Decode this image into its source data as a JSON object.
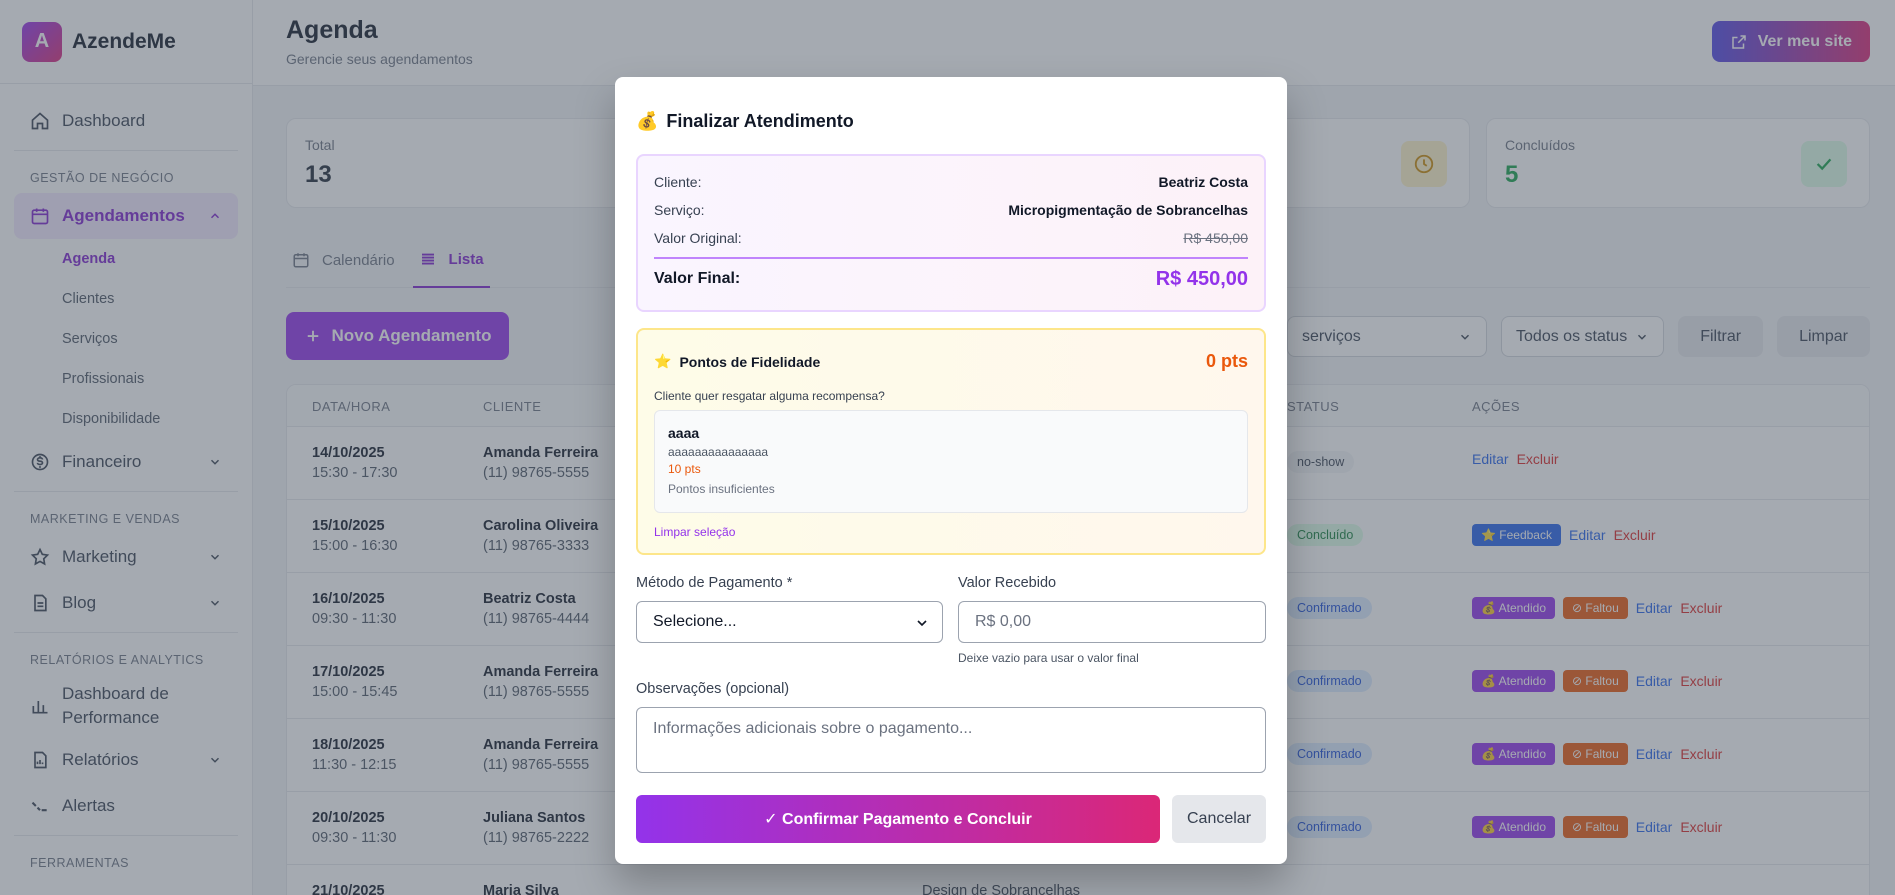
{
  "brand": {
    "logo_letter": "A",
    "name": "AzendeMe"
  },
  "sidebar": {
    "dashboard": "Dashboard",
    "section_business": "GESTÃO DE NEGÓCIO",
    "agendamentos": "Agendamentos",
    "sub_items": [
      "Agenda",
      "Clientes",
      "Serviços",
      "Profissionais",
      "Disponibilidade"
    ],
    "financeiro": "Financeiro",
    "section_marketing": "MARKETING E VENDAS",
    "marketing": "Marketing",
    "blog": "Blog",
    "section_reports": "RELATÓRIOS E ANALYTICS",
    "dashboard_perf_line1": "Dashboard de",
    "dashboard_perf_line2": "Performance",
    "relatorios": "Relatórios",
    "alertas": "Alertas",
    "section_tools": "FERRAMENTAS"
  },
  "header": {
    "title": "Agenda",
    "subtitle": "Gerencie seus agendamentos",
    "site_button": "Ver meu site"
  },
  "stats": [
    {
      "label": "Total",
      "value": "13"
    },
    {
      "label": "Concluídos",
      "value": "5"
    }
  ],
  "tabs": {
    "calendar": "Calendário",
    "list": "Lista"
  },
  "new_button": "Novo Agendamento",
  "filters": {
    "services": "serviços",
    "status": "Todos os status",
    "filter": "Filtrar",
    "clear": "Limpar"
  },
  "table": {
    "headers": {
      "datetime": "DATA/HORA",
      "client": "CLIENTE",
      "status": "STATUS",
      "actions": "AÇÕES"
    },
    "rows": [
      {
        "date": "14/10/2025",
        "time": "15:30 - 17:30",
        "client": "Amanda Ferreira",
        "phone": "(11) 98765-5555",
        "status": "no-show"
      },
      {
        "date": "15/10/2025",
        "time": "15:00 - 16:30",
        "client": "Carolina Oliveira",
        "phone": "(11) 98765-3333",
        "status": "Concluído"
      },
      {
        "date": "16/10/2025",
        "time": "09:30 - 11:30",
        "client": "Beatriz Costa",
        "phone": "(11) 98765-4444",
        "status": "Confirmado"
      },
      {
        "date": "17/10/2025",
        "time": "15:00 - 15:45",
        "client": "Amanda Ferreira",
        "phone": "(11) 98765-5555",
        "status": "Confirmado"
      },
      {
        "date": "18/10/2025",
        "time": "11:30 - 12:15",
        "client": "Amanda Ferreira",
        "phone": "(11) 98765-5555",
        "status": "Confirmado"
      },
      {
        "date": "20/10/2025",
        "time": "09:30 - 11:30",
        "client": "Juliana Santos",
        "phone": "(11) 98765-2222",
        "status": "Confirmado"
      },
      {
        "date": "21/10/2025",
        "time": "",
        "client": "Maria Silva",
        "phone": "",
        "status": ""
      }
    ],
    "service_partial": "Design de Sobrancelhas",
    "actions": {
      "edit": "Editar",
      "delete": "Excluir",
      "feedback": "Feedback",
      "attended": "Atendido",
      "missed": "Faltou"
    }
  },
  "modal": {
    "title": "Finalizar Atendimento",
    "summary": {
      "client_label": "Cliente:",
      "client_value": "Beatriz Costa",
      "service_label": "Serviço:",
      "service_value": "Micropigmentação de Sobrancelhas",
      "original_label": "Valor Original:",
      "original_value": "R$ 450,00",
      "final_label": "Valor Final:",
      "final_value": "R$ 450,00"
    },
    "loyalty": {
      "title": "Pontos de Fidelidade",
      "points": "0 pts",
      "question": "Cliente quer resgatar alguma recompensa?",
      "reward_name": "aaaa",
      "reward_desc": "aaaaaaaaaaaaaaa",
      "reward_points": "10 pts",
      "reward_status": "Pontos insuficientes",
      "clear": "Limpar seleção"
    },
    "payment_label": "Método de Pagamento *",
    "payment_value": "Selecione...",
    "received_label": "Valor Recebido",
    "received_placeholder": "R$ 0,00",
    "received_hint": "Deixe vazio para usar o valor final",
    "notes_label": "Observações (opcional)",
    "notes_placeholder": "Informações adicionais sobre o pagamento...",
    "confirm": "✓ Confirmar Pagamento e Concluir",
    "cancel": "Cancelar"
  },
  "colors": {
    "accent": "#9333ea",
    "pink": "#db2777",
    "orange": "#ea580c"
  }
}
